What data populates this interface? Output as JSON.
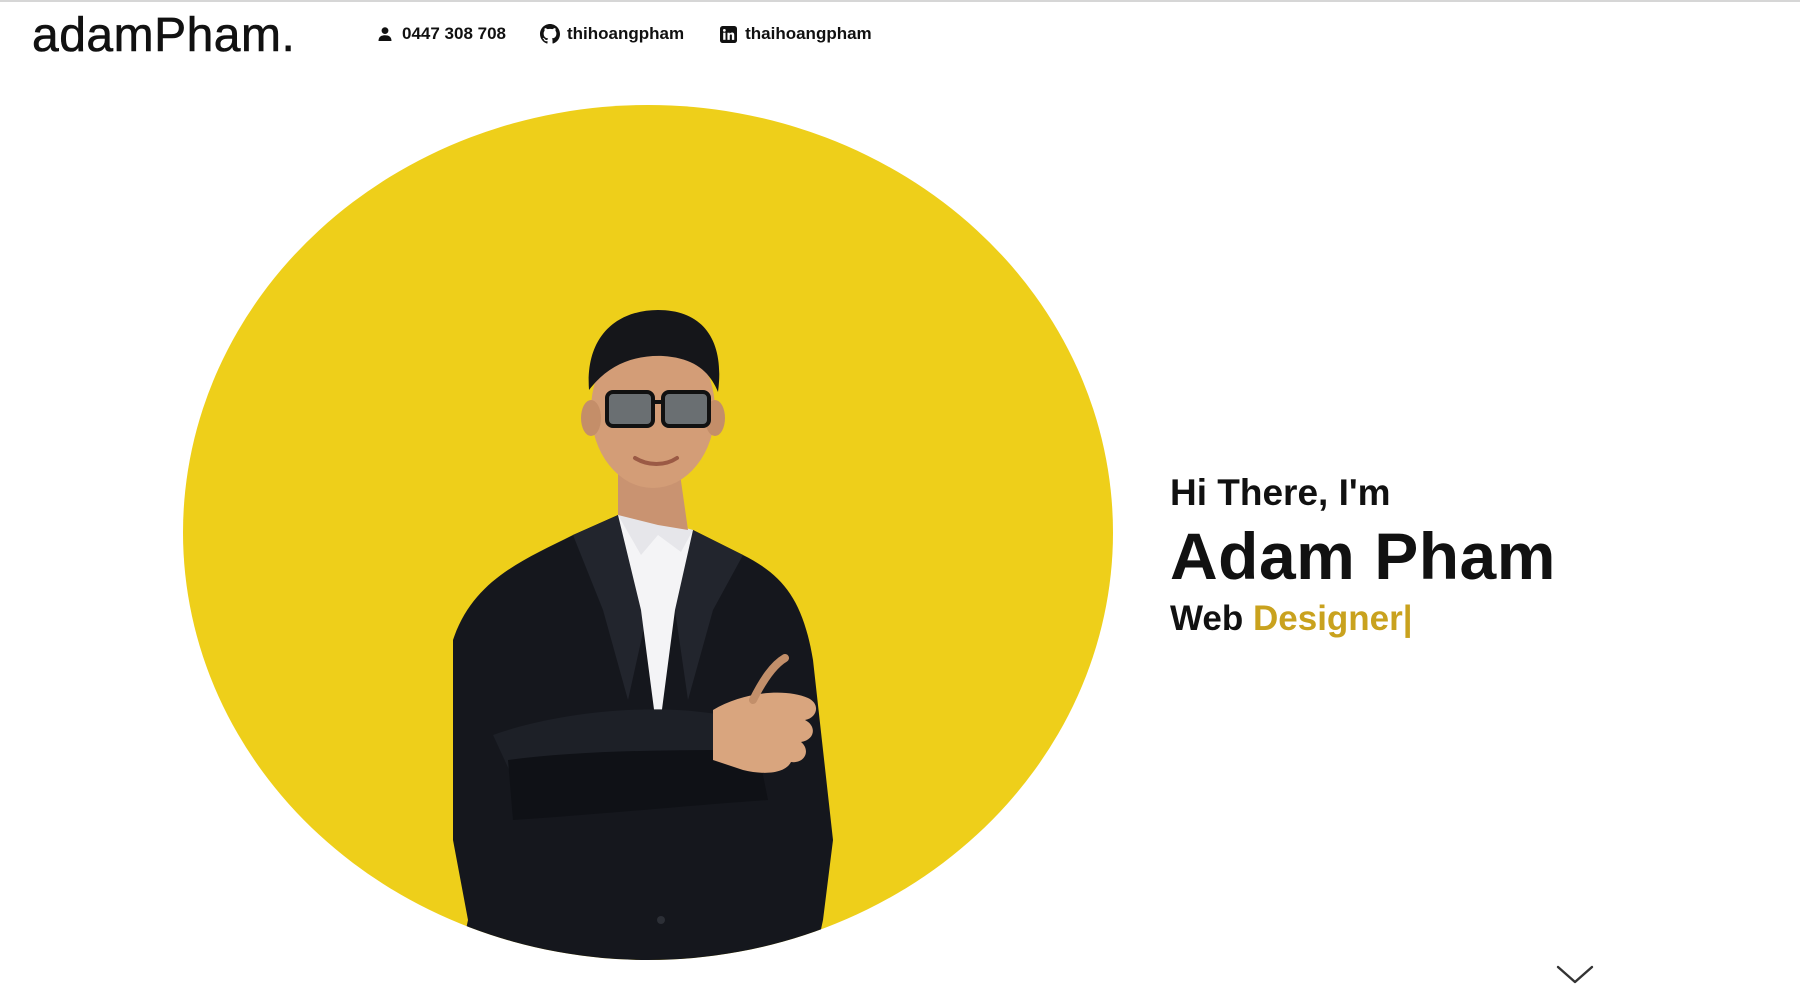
{
  "header": {
    "logo": "adamPham.",
    "contacts": [
      {
        "icon": "person-icon",
        "label": "0447 308 708"
      },
      {
        "icon": "github-icon",
        "label": "thihoangpham"
      },
      {
        "icon": "linkedin-icon",
        "label": "thaihoangpham"
      }
    ]
  },
  "hero": {
    "greeting": "Hi There, I'm",
    "name": "Adam Pham",
    "role_prefix": "Web",
    "role_typed": "Designer|",
    "circle_color": "#eecf1a",
    "accent_color": "#c9a21e",
    "scroll_icon": "chevron-down-icon"
  }
}
